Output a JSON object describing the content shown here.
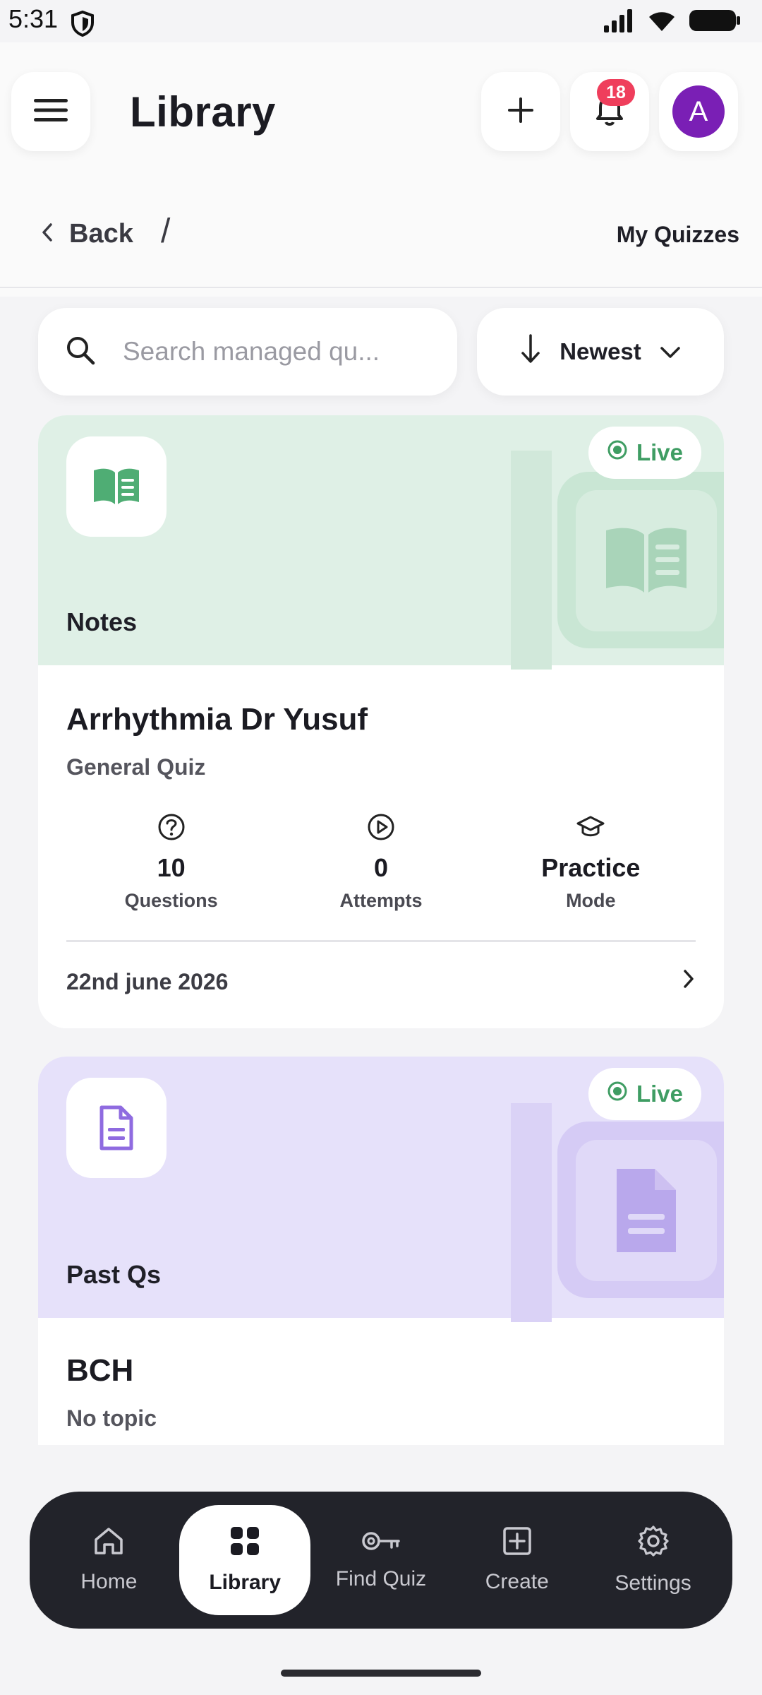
{
  "status_bar": {
    "time": "5:31"
  },
  "header": {
    "title": "Library",
    "notification_count": "18",
    "avatar_initial": "A"
  },
  "breadcrumb": {
    "back_label": "Back",
    "separator": "/",
    "current": "My Quizzes"
  },
  "search": {
    "placeholder": "Search managed qu...",
    "value": ""
  },
  "sort": {
    "label": "Newest"
  },
  "cards": [
    {
      "category": "Notes",
      "status": "Live",
      "title": "Arrhythmia Dr Yusuf",
      "subtitle": "General Quiz",
      "stats": [
        {
          "value": "10",
          "label": "Questions",
          "icon": "question-circle-icon"
        },
        {
          "value": "0",
          "label": "Attempts",
          "icon": "play-circle-icon"
        },
        {
          "value": "Practice",
          "label": "Mode",
          "icon": "graduation-cap-icon"
        }
      ],
      "date": "22nd june 2026",
      "colors": {
        "bg": "#dff0e6",
        "accent": "#4fad74"
      }
    },
    {
      "category": "Past Qs",
      "status": "Live",
      "title": "BCH",
      "subtitle": "No topic",
      "colors": {
        "bg": "#e6e1fa",
        "accent": "#8f6be0"
      }
    }
  ],
  "nav": [
    {
      "label": "Home",
      "icon": "home-icon"
    },
    {
      "label": "Library",
      "icon": "grid-icon"
    },
    {
      "label": "Find Quiz",
      "icon": "key-icon"
    },
    {
      "label": "Create",
      "icon": "plus-square-icon"
    },
    {
      "label": "Settings",
      "icon": "gear-icon"
    }
  ],
  "colors": {
    "live_green": "#3f9d63",
    "badge_red": "#ef3e5c",
    "avatar_purple": "#7a1fb5",
    "nav_bg": "#22232a"
  }
}
